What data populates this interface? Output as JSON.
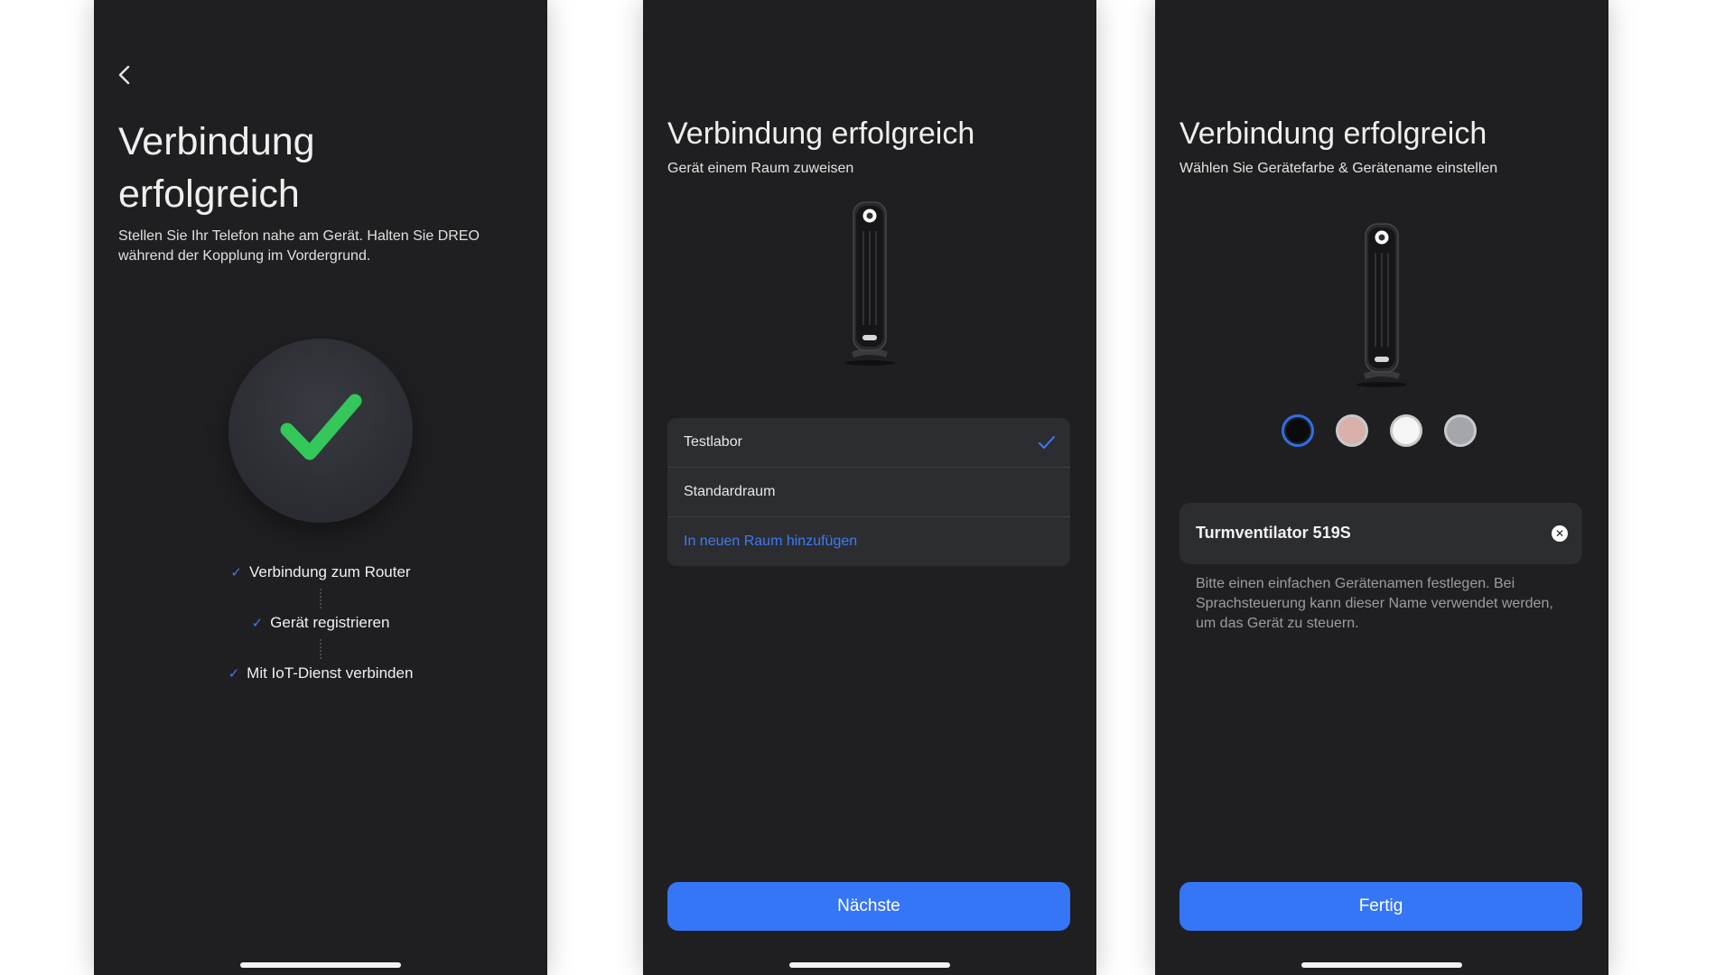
{
  "screen1": {
    "title_line1": "Verbindung",
    "title_line2": "erfolgreich",
    "description": "Stellen Sie Ihr Telefon nahe am Gerät. Halten Sie DREO während der Kopplung im Vordergrund.",
    "steps": [
      {
        "label": "Verbindung zum Router",
        "status": "done"
      },
      {
        "label": "Gerät registrieren",
        "status": "done"
      },
      {
        "label": "Mit IoT-Dienst verbinden",
        "status": "done"
      }
    ]
  },
  "screen2": {
    "title": "Verbindung erfolgreich",
    "subtitle": "Gerät einem Raum zuweisen",
    "rooms": [
      {
        "label": "Testlabor",
        "selected": true
      },
      {
        "label": "Standardraum",
        "selected": false
      }
    ],
    "add_room_label": "In neuen Raum hinzufügen",
    "next_button": "Nächste"
  },
  "screen3": {
    "title": "Verbindung erfolgreich",
    "subtitle": "Wählen Sie Gerätefarbe & Gerätename einstellen",
    "color_options": [
      {
        "color": "#0b0b0c",
        "selected": true
      },
      {
        "color": "#d9b1aa",
        "selected": false
      },
      {
        "color": "#f5f5f5",
        "selected": false
      },
      {
        "color": "#a3a6ab",
        "selected": false
      }
    ],
    "device_name": "Turmventilator 519S",
    "hint": "Bitte einen einfachen Gerätenamen festlegen. Bei Sprachsteuerung kann dieser Name verwendet werden, um das Gerät zu steuern.",
    "done_button": "Fertig"
  },
  "colors": {
    "accent": "#3576f6",
    "check_green": "#34c759",
    "background": "#1f1f21",
    "surface": "#2c2d31"
  },
  "icons": [
    "back-arrow-icon",
    "success-check-icon",
    "step-check-icon",
    "room-check-icon",
    "tower-fan-icon",
    "clear-icon"
  ]
}
